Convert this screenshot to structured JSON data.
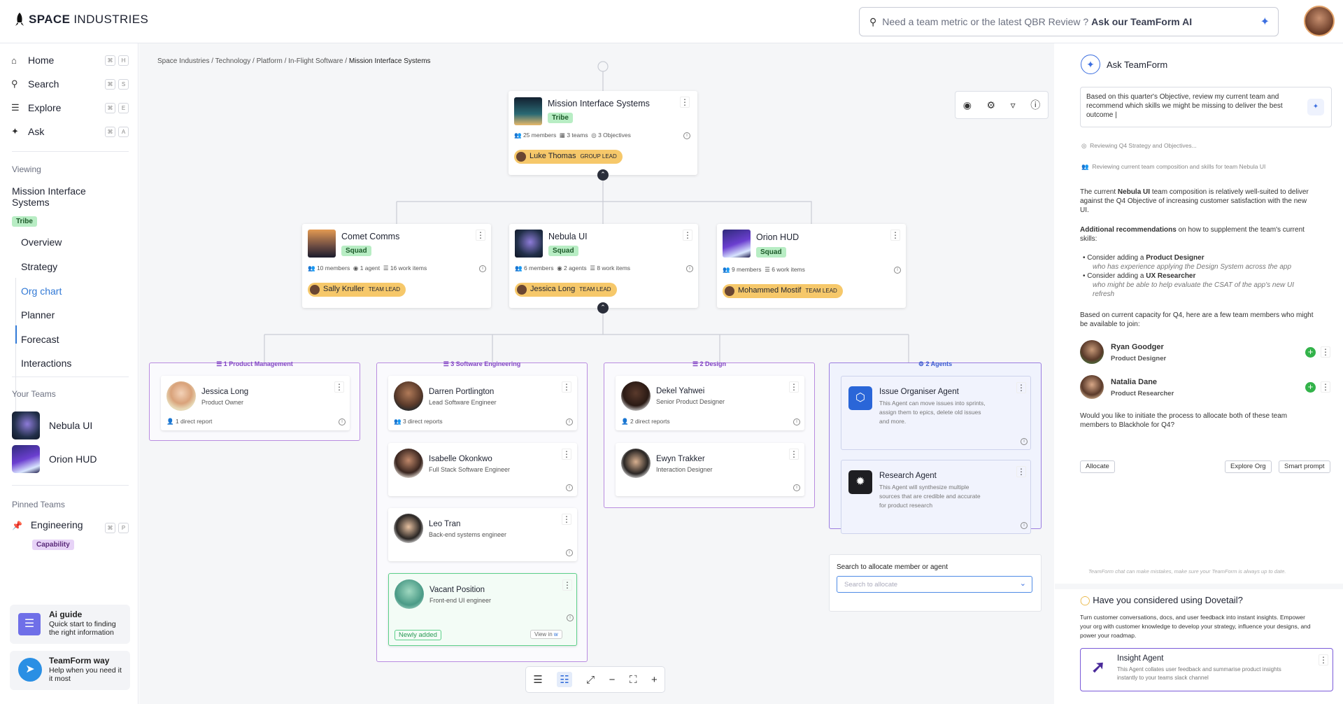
{
  "brand": {
    "bold": "SPACE",
    "light": "INDUSTRIES"
  },
  "search": {
    "placeholder": "Need a team metric or the latest QBR Review ?",
    "cta": "Ask our TeamForm AI"
  },
  "nav": [
    {
      "label": "Home",
      "key": "H",
      "icon": "home-icon"
    },
    {
      "label": "Search",
      "key": "S",
      "icon": "search-icon"
    },
    {
      "label": "Explore",
      "key": "E",
      "icon": "layers-icon"
    },
    {
      "label": "Ask",
      "key": "A",
      "icon": "sparkle-icon"
    }
  ],
  "viewing": {
    "heading": "Viewing",
    "name": "Mission Interface Systems",
    "type": "Tribe"
  },
  "subnav": [
    "Overview",
    "Strategy",
    "Org chart",
    "Planner",
    "Forecast",
    "Interactions"
  ],
  "your_teams": {
    "heading": "Your Teams",
    "items": [
      "Nebula UI",
      "Orion HUD"
    ]
  },
  "pinned": {
    "heading": "Pinned Teams",
    "name": "Engineering",
    "type": "Capability",
    "key": "P"
  },
  "guides": [
    {
      "title": "Ai guide",
      "text": "Quick start to finding the right information"
    },
    {
      "title": "TeamForm way",
      "text": "Help when you need it it most"
    }
  ],
  "breadcrumb": {
    "path": "Space Industries / Technology / Platform / In-Flight Software / ",
    "current": "Mission Interface Systems"
  },
  "tribe": {
    "name": "Mission Interface Systems",
    "type": "Tribe",
    "members": "25 members",
    "teams": "3 teams",
    "objectives": "3 Objectives",
    "lead": "Luke Thomas",
    "lead_role": "GROUP LEAD"
  },
  "squads": [
    {
      "name": "Comet Comms",
      "type": "Squad",
      "stats": [
        "10 members",
        "1 agent",
        "16 work items"
      ],
      "lead": "Sally Kruller",
      "lead_role": "TEAM LEAD"
    },
    {
      "name": "Nebula UI",
      "type": "Squad",
      "stats": [
        "6 members",
        "2 agents",
        "8 work items"
      ],
      "lead": "Jessica Long",
      "lead_role": "TEAM LEAD"
    },
    {
      "name": "Orion HUD",
      "type": "Squad",
      "stats": [
        "9 members",
        "6 work items"
      ],
      "lead": "Mohammed Mostif",
      "lead_role": "TEAM LEAD"
    }
  ],
  "groups": {
    "pm": {
      "title": "1 Product Management",
      "people": [
        {
          "name": "Jessica Long",
          "role": "Product Owner",
          "reports": "1 direct report"
        }
      ]
    },
    "se": {
      "title": "3 Software Engineering",
      "people": [
        {
          "name": "Darren Portlington",
          "role": "Lead Software Engineer",
          "reports": "3 direct reports"
        },
        {
          "name": "Isabelle Okonkwo",
          "role": "Full Stack Software Engineer"
        },
        {
          "name": "Leo Tran",
          "role": "Back-end systems engineer"
        },
        {
          "name": "Vacant Position",
          "role": "Front-end UI engineer",
          "badge": "Newly added",
          "view": "View in"
        }
      ]
    },
    "design": {
      "title": "2 Design",
      "people": [
        {
          "name": "Dekel Yahwei",
          "role": "Senior Product Designer",
          "reports": "2 direct reports"
        },
        {
          "name": "Ewyn Trakker",
          "role": "Interaction Designer"
        }
      ]
    },
    "agents": {
      "title": "2 Agents",
      "items": [
        {
          "name": "Issue Organiser Agent",
          "desc": [
            "This Agent can move issues into sprints,",
            "assign them to epics, delete old issues",
            "and more."
          ]
        },
        {
          "name": "Research Agent",
          "desc": [
            "This Agent will synthesize multiple",
            "sources that are credible and accurate",
            "for product research"
          ]
        }
      ]
    }
  },
  "allocate": {
    "label": "Search to allocate member or agent",
    "placeholder": "Search to allocate"
  },
  "ai": {
    "title": "Ask TeamForm",
    "prompt": "Based on this quarter's Objective, review my current team and recommend which skills we might be missing to deliver the best outcome |",
    "steps": [
      "Reviewing Q4 Strategy and Objectives...",
      "Reviewing current team composition and skills for team Nebula UI"
    ],
    "p1a": "The current ",
    "p1b": "Nebula UI",
    "p1c": " team composition is relatively well-suited to deliver",
    "p1d": "against the Q4 Objective of increasing customer satisfaction with the new",
    "p1e": "UI.",
    "p2a": "Additional recommendations",
    "p2b": " on how to supplement the team's current",
    "p2c": "skills:",
    "b1a": "Consider adding a ",
    "b1b": "Product Designer",
    "b1c": "who has experience applying the Design System across the app",
    "b2a": "Consider adding a ",
    "b2b": "UX Researcher",
    "b2c": "who might be able to help evaluate the CSAT of the app's new UI",
    "b2d": "refresh",
    "p3a": "Based on current capacity for Q4, here are a few team members who might",
    "p3b": "be available to join:",
    "candidates": [
      {
        "name": "Ryan Goodger",
        "role": "Product Designer"
      },
      {
        "name": "Natalia Dane",
        "role": "Product Researcher"
      }
    ],
    "p4a": "Would you like to initiate the process to allocate both of these team",
    "p4b": "members to Blackhole for Q4?",
    "actions": [
      "Allocate",
      "Explore Org",
      "Smart prompt"
    ],
    "disclaimer": "TeamForm chat can make mistakes, make sure your TeamForm is always up to date."
  },
  "dovetail": {
    "title": "Have you considered using Dovetail?",
    "lines": [
      "Turn customer conversations, docs, and user feedback into instant insights. Empower",
      "your org with customer knowledge to develop your strategy, influence your designs, and",
      "power your roadmap."
    ],
    "agent": "Insight Agent",
    "agent_desc": [
      "This Agent collates user feedback and summarise product insights",
      "instantly to your teams slack channel"
    ]
  }
}
